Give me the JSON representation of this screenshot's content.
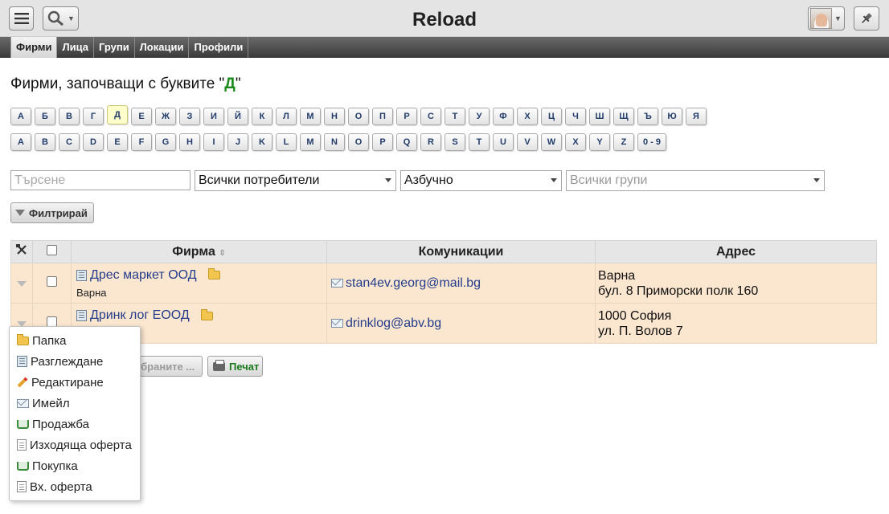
{
  "app": {
    "title": "Reload"
  },
  "toolbar": {
    "menu_icon": "hamburger-icon",
    "search_icon": "search-icon",
    "pin_icon": "pin-icon"
  },
  "tabs": [
    {
      "label": "Фирми",
      "active": true
    },
    {
      "label": "Лица",
      "active": false
    },
    {
      "label": "Групи",
      "active": false
    },
    {
      "label": "Локации",
      "active": false
    },
    {
      "label": "Профили",
      "active": false
    }
  ],
  "heading": {
    "prefix": "Фирми, започващи с буквите \"",
    "letter": "Д",
    "suffix": "\""
  },
  "letters_cyr": [
    "А",
    "Б",
    "В",
    "Г",
    "Д",
    "Е",
    "Ж",
    "З",
    "И",
    "Й",
    "К",
    "Л",
    "М",
    "Н",
    "О",
    "П",
    "Р",
    "С",
    "Т",
    "У",
    "Ф",
    "Х",
    "Ц",
    "Ч",
    "Ш",
    "Щ",
    "Ъ",
    "Ю",
    "Я"
  ],
  "letters_lat": [
    "A",
    "B",
    "C",
    "D",
    "E",
    "F",
    "G",
    "H",
    "I",
    "J",
    "K",
    "L",
    "M",
    "N",
    "O",
    "P",
    "Q",
    "R",
    "S",
    "T",
    "U",
    "V",
    "W",
    "X",
    "Y",
    "Z",
    "0 - 9"
  ],
  "active_letter": "Д",
  "filters": {
    "search_placeholder": "Търсене",
    "users": "Всички потребители",
    "order": "Азбучно",
    "groups_placeholder": "Всички групи",
    "filter_button": "Филтрирай"
  },
  "table": {
    "headers": {
      "firm": "Фирма",
      "communications": "Комуникации",
      "address": "Адрес"
    },
    "rows": [
      {
        "name": "Дрес маркет ООД",
        "city": "Варна",
        "email": "stan4ev.georg@mail.bg",
        "address_line1": "Варна",
        "address_line2": "бул. 8 Приморски полк 160"
      },
      {
        "name": "Дринк лог ЕООД",
        "city": "",
        "email": "drinklog@abv.bg",
        "address_line1": "1000 София",
        "address_line2": "ул. П. Волов 7"
      }
    ]
  },
  "actions": {
    "selected_label": "збраните ...",
    "print_label": "Печат"
  },
  "context_menu": [
    {
      "label": "Папка",
      "icon": "folder-icon"
    },
    {
      "label": "Разглеждане",
      "icon": "building-icon"
    },
    {
      "label": "Редактиране",
      "icon": "pencil-icon"
    },
    {
      "label": "Имейл",
      "icon": "email-icon"
    },
    {
      "label": "Продажба",
      "icon": "cart-icon"
    },
    {
      "label": "Изходяща оферта",
      "icon": "document-icon"
    },
    {
      "label": "Покупка",
      "icon": "cart-icon"
    },
    {
      "label": "Вх. оферта",
      "icon": "document-icon"
    }
  ]
}
